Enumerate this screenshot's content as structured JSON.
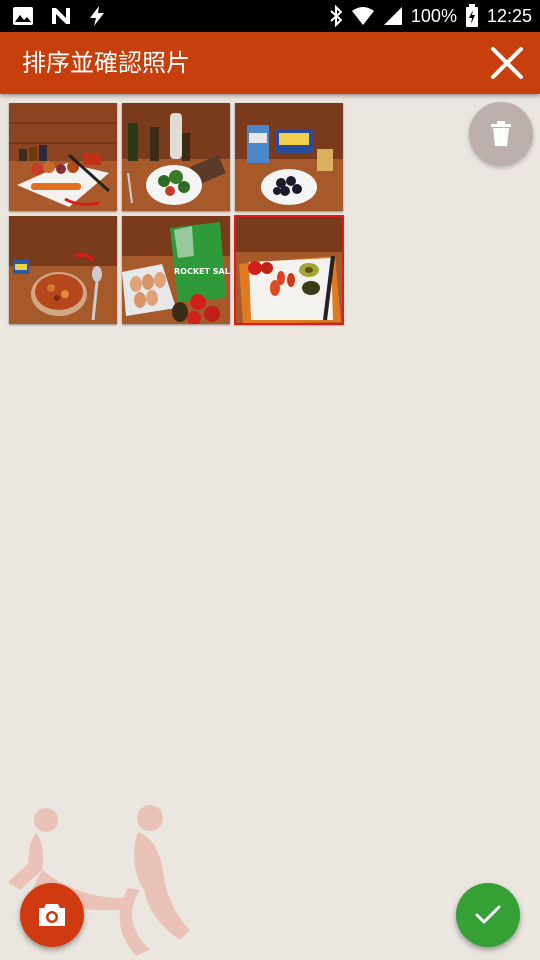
{
  "status_bar": {
    "battery_text": "100%",
    "time": "12:25",
    "icons": [
      "image-icon",
      "n-notification-icon",
      "flash-icon",
      "bluetooth-icon",
      "wifi-icon",
      "signal-icon",
      "battery-charging-icon"
    ]
  },
  "app_bar": {
    "title": "排序並確認照片",
    "close_icon": "close-icon",
    "color": "#c63f0c"
  },
  "photos": [
    {
      "subject": "spices-onion-carrot-knife",
      "selected": false
    },
    {
      "subject": "oil-pepper-salad-plate",
      "selected": false
    },
    {
      "subject": "milk-butter-blueberries",
      "selected": false
    },
    {
      "subject": "chili-bowl-spoon",
      "selected": false
    },
    {
      "subject": "eggs-rocket-salad-mix-tomatoes",
      "selected": false
    },
    {
      "subject": "tomatoes-avocado-cutting-board",
      "selected": true
    }
  ],
  "photo_labels": {
    "rocket_bag": "ROCKET SALAD MIX"
  },
  "fabs": {
    "delete_icon": "trash-icon",
    "camera_icon": "camera-icon",
    "confirm_icon": "check-icon",
    "camera_color": "#d03a10",
    "confirm_color": "#35a036",
    "selection_color": "#e8151a"
  }
}
